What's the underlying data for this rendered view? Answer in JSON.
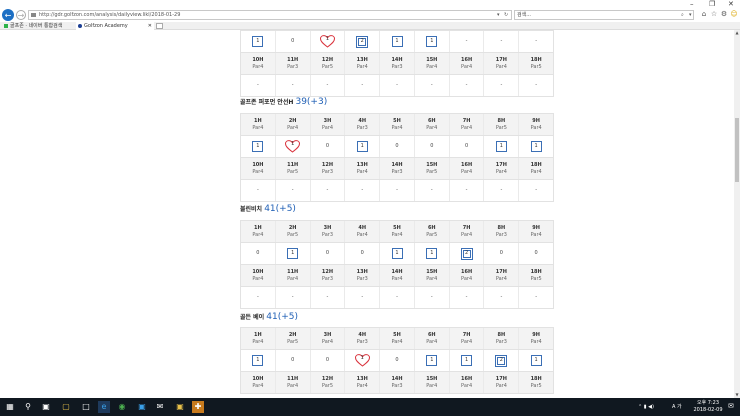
{
  "browser": {
    "url": "http://gdr.golfzon.com/analysis/dailyview.likl/2018-01-29",
    "search_placeholder": "검색...",
    "tabs": [
      {
        "label": "골프존 · 네이버 통합검색"
      },
      {
        "label": "Golfzon Academy"
      }
    ]
  },
  "players": [
    {
      "name": "",
      "score": "",
      "rows": [
        {
          "type": "score",
          "cells": [
            "1",
            "0",
            "h1",
            "d2",
            "1",
            "1",
            "-",
            "-",
            "-"
          ]
        },
        {
          "type": "head",
          "cells": [
            [
              "10H",
              "Par4"
            ],
            [
              "11H",
              "Par3"
            ],
            [
              "12H",
              "Par5"
            ],
            [
              "13H",
              "Par4"
            ],
            [
              "14H",
              "Par3"
            ],
            [
              "15H",
              "Par4"
            ],
            [
              "16H",
              "Par4"
            ],
            [
              "17H",
              "Par4"
            ],
            [
              "18H",
              "Par5"
            ]
          ]
        },
        {
          "type": "score",
          "cells": [
            "-",
            "-",
            "-",
            "-",
            "-",
            "-",
            "-",
            "-",
            "-"
          ]
        }
      ]
    },
    {
      "name": "골프존 퍼포먼 안선H",
      "score": "39(+3)",
      "rows": [
        {
          "type": "head",
          "cells": [
            [
              "1H",
              "Par4"
            ],
            [
              "2H",
              "Par4"
            ],
            [
              "3H",
              "Par4"
            ],
            [
              "4H",
              "Par3"
            ],
            [
              "5H",
              "Par4"
            ],
            [
              "6H",
              "Par4"
            ],
            [
              "7H",
              "Par4"
            ],
            [
              "8H",
              "Par5"
            ],
            [
              "9H",
              "Par4"
            ]
          ]
        },
        {
          "type": "score",
          "cells": [
            "1",
            "h1",
            "0",
            "1",
            "0",
            "0",
            "0",
            "1",
            "1"
          ]
        },
        {
          "type": "head",
          "cells": [
            [
              "10H",
              "Par4"
            ],
            [
              "11H",
              "Par5"
            ],
            [
              "12H",
              "Par3"
            ],
            [
              "13H",
              "Par4"
            ],
            [
              "14H",
              "Par3"
            ],
            [
              "15H",
              "Par5"
            ],
            [
              "16H",
              "Par4"
            ],
            [
              "17H",
              "Par4"
            ],
            [
              "18H",
              "Par4"
            ]
          ]
        },
        {
          "type": "score",
          "cells": [
            "-",
            "-",
            "-",
            "-",
            "-",
            "-",
            "-",
            "-",
            "-"
          ]
        }
      ]
    },
    {
      "name": "블린비치",
      "score": "41(+5)",
      "rows": [
        {
          "type": "head",
          "cells": [
            [
              "1H",
              "Par4"
            ],
            [
              "2H",
              "Par5"
            ],
            [
              "3H",
              "Par3"
            ],
            [
              "4H",
              "Par4"
            ],
            [
              "5H",
              "Par4"
            ],
            [
              "6H",
              "Par5"
            ],
            [
              "7H",
              "Par4"
            ],
            [
              "8H",
              "Par3"
            ],
            [
              "9H",
              "Par4"
            ]
          ]
        },
        {
          "type": "score",
          "cells": [
            "0",
            "1",
            "0",
            "0",
            "1",
            "1",
            "d2",
            "0",
            "0"
          ]
        },
        {
          "type": "head",
          "cells": [
            [
              "10H",
              "Par4"
            ],
            [
              "11H",
              "Par4"
            ],
            [
              "12H",
              "Par3"
            ],
            [
              "13H",
              "Par3"
            ],
            [
              "14H",
              "Par4"
            ],
            [
              "15H",
              "Par4"
            ],
            [
              "16H",
              "Par4"
            ],
            [
              "17H",
              "Par4"
            ],
            [
              "18H",
              "Par5"
            ]
          ]
        },
        {
          "type": "score",
          "cells": [
            "-",
            "-",
            "-",
            "-",
            "-",
            "-",
            "-",
            "-",
            "-"
          ]
        }
      ]
    },
    {
      "name": "골든 베이",
      "score": "41(+5)",
      "rows": [
        {
          "type": "head",
          "cells": [
            [
              "1H",
              "Par4"
            ],
            [
              "2H",
              "Par5"
            ],
            [
              "3H",
              "Par4"
            ],
            [
              "4H",
              "Par3"
            ],
            [
              "5H",
              "Par4"
            ],
            [
              "6H",
              "Par4"
            ],
            [
              "7H",
              "Par4"
            ],
            [
              "8H",
              "Par3"
            ],
            [
              "9H",
              "Par4"
            ]
          ]
        },
        {
          "type": "score",
          "cells": [
            "1",
            "0",
            "0",
            "h1",
            "0",
            "1",
            "1",
            "d2",
            "1"
          ]
        },
        {
          "type": "head",
          "cells": [
            [
              "10H",
              "Par4"
            ],
            [
              "11H",
              "Par4"
            ],
            [
              "12H",
              "Par5"
            ],
            [
              "13H",
              "Par4"
            ],
            [
              "14H",
              "Par3"
            ],
            [
              "15H",
              "Par4"
            ],
            [
              "16H",
              "Par4"
            ],
            [
              "17H",
              "Par4"
            ],
            [
              "18H",
              "Par5"
            ]
          ]
        }
      ]
    }
  ],
  "taskbar": {
    "time": "오후 7:23",
    "date": "2018-02-09",
    "tray_text": "A 가"
  },
  "colors": {
    "box": "#3b6fb5",
    "heart": "#d9313b",
    "score": "#1f5fb5",
    "taskbar": "#101820"
  }
}
